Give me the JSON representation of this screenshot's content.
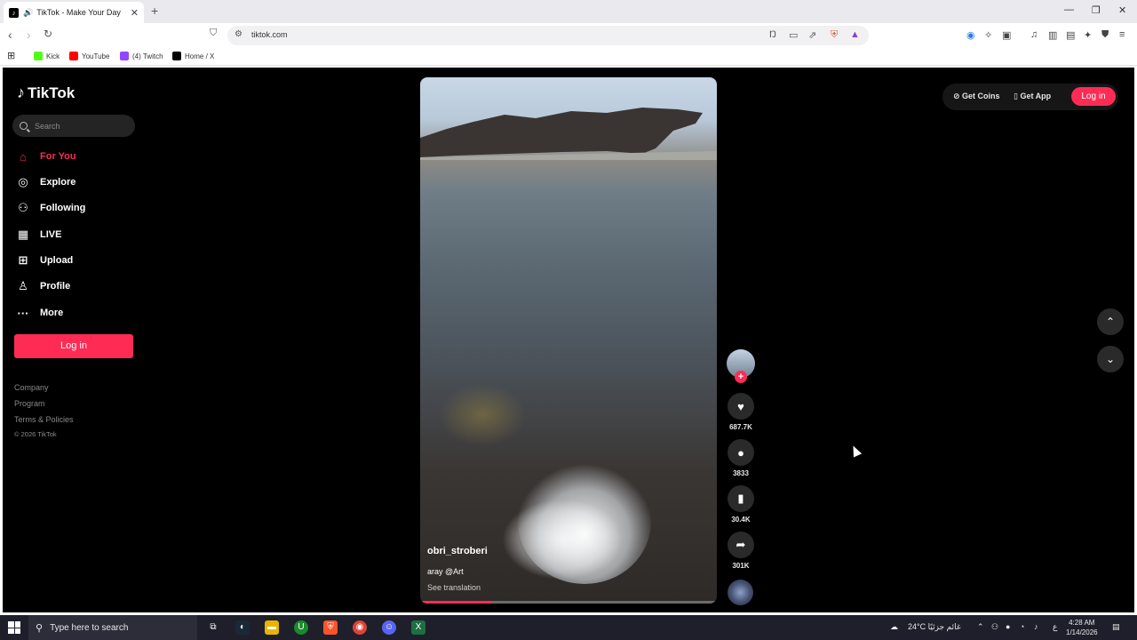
{
  "browser": {
    "tab_title": "TikTok - Make Your Day",
    "url": "tiktok.com",
    "bookmarks": [
      "Kick",
      "YouTube",
      "(4) Twitch",
      "Home / X"
    ]
  },
  "sidebar": {
    "logo": "TikTok",
    "search_placeholder": "Search",
    "items": [
      {
        "label": "For You",
        "icon": "home-icon"
      },
      {
        "label": "Explore",
        "icon": "compass-icon"
      },
      {
        "label": "Following",
        "icon": "following-icon"
      },
      {
        "label": "LIVE",
        "icon": "live-icon"
      },
      {
        "label": "Upload",
        "icon": "upload-icon"
      },
      {
        "label": "Profile",
        "icon": "profile-icon"
      },
      {
        "label": "More",
        "icon": "more-icon"
      }
    ],
    "login_label": "Log in",
    "footer": [
      "Company",
      "Program",
      "Terms & Policies"
    ],
    "copyright": "© 2026 TikTok"
  },
  "header_right": {
    "get_coins": "Get Coins",
    "get_app": "Get App",
    "login": "Log in"
  },
  "video": {
    "username": "obri_stroberi",
    "description": "aray @Art",
    "see_translation": "See translation",
    "progress": 0.24
  },
  "actions": {
    "likes": "687.7K",
    "comments": "3833",
    "saves": "30.4K",
    "shares": "301K"
  },
  "taskbar": {
    "search_placeholder": "Type here to search",
    "weather": "24°C  غائم جزئيًا",
    "time": "4:28 AM",
    "date": "1/14/2026",
    "lang": "ع"
  },
  "colors": {
    "accent": "#fe2c55",
    "page_bg": "#000000"
  }
}
